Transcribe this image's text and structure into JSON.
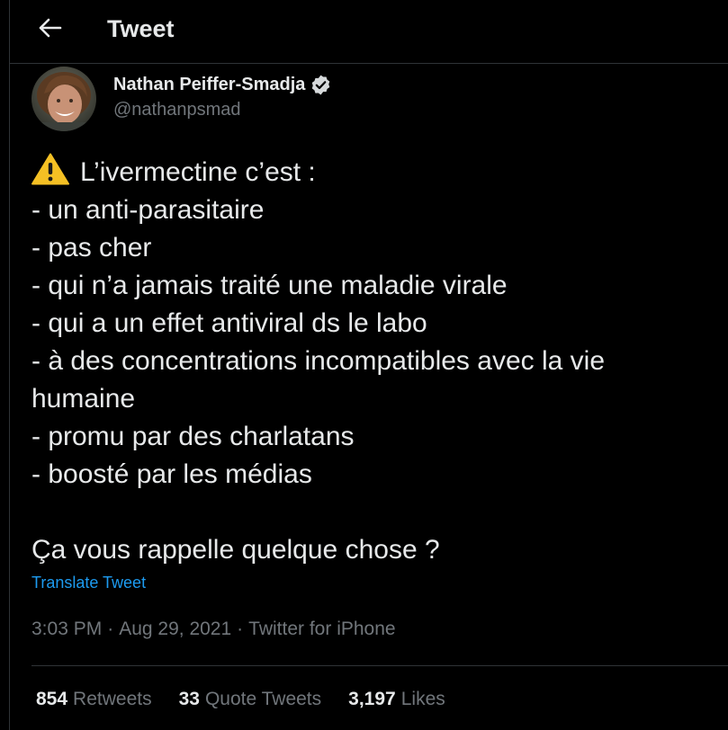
{
  "header": {
    "title": "Tweet",
    "back_icon": "arrow-left-icon"
  },
  "author": {
    "name": "Nathan Peiffer-Smadja",
    "handle": "@nathanpsmad",
    "verified": true,
    "verified_icon": "verified-badge-icon"
  },
  "tweet": {
    "warning_icon": "warning-icon",
    "lines": [
      "L’ivermectine c’est :",
      "- un anti-parasitaire",
      "- pas cher",
      "- qui n’a jamais traité une maladie virale",
      "- qui a un effet antiviral ds le labo",
      "- à des concentrations incompatibles avec la vie",
      "humaine",
      "- promu par des charlatans",
      "- boosté par les médias",
      "",
      "Ça vous rappelle quelque chose ?"
    ],
    "translate_label": "Translate Tweet"
  },
  "meta": {
    "time": "3:03 PM",
    "separator": "·",
    "date": "Aug 29, 2021",
    "source": "Twitter for iPhone"
  },
  "stats": [
    {
      "value": "854",
      "label": "Retweets"
    },
    {
      "value": "33",
      "label": "Quote Tweets"
    },
    {
      "value": "3,197",
      "label": "Likes"
    }
  ],
  "colors": {
    "background": "#000000",
    "text": "#e7e9ea",
    "muted": "#71767b",
    "link": "#1d9bf0",
    "border": "#2f3336",
    "verified": "#d6d9db"
  }
}
